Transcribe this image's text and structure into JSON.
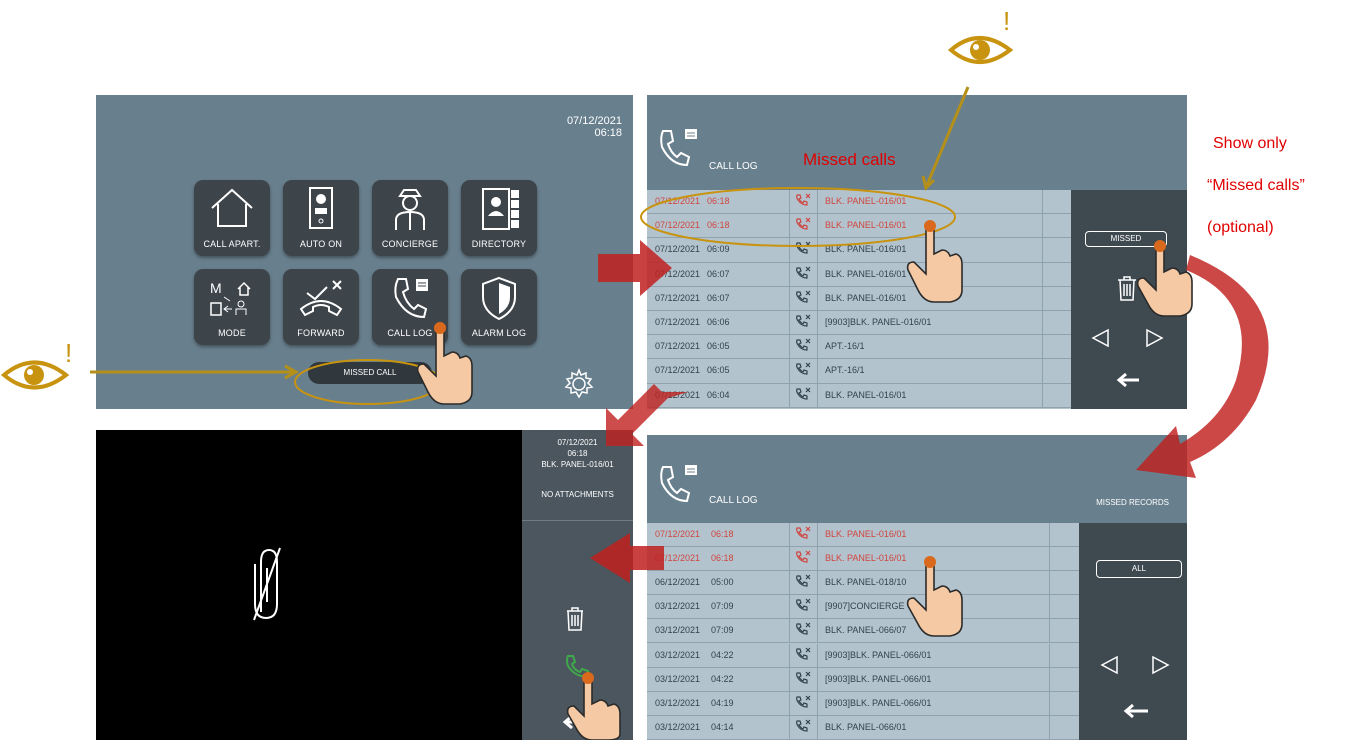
{
  "home": {
    "date": "07/12/2021",
    "time": "06:18",
    "tiles": [
      {
        "label": "CALL APART."
      },
      {
        "label": "AUTO ON"
      },
      {
        "label": "CONCIERGE"
      },
      {
        "label": "DIRECTORY"
      },
      {
        "label": "MODE"
      },
      {
        "label": "FORWARD"
      },
      {
        "label": "CALL LOG"
      },
      {
        "label": "ALARM LOG"
      }
    ],
    "missed_call": "MISSED CALL"
  },
  "call_log": {
    "title": "CALL LOG",
    "missed_button": "MISSED",
    "rows": [
      {
        "date": "07/12/2021",
        "time": "06:18",
        "name": "BLK. PANEL-016/01",
        "missed": true
      },
      {
        "date": "07/12/2021",
        "time": "06:18",
        "name": "BLK. PANEL-016/01",
        "missed": true
      },
      {
        "date": "07/12/2021",
        "time": "06:09",
        "name": "BLK. PANEL-016/01",
        "missed": false
      },
      {
        "date": "07/12/2021",
        "time": "06:07",
        "name": "BLK. PANEL-016/01",
        "missed": false
      },
      {
        "date": "07/12/2021",
        "time": "06:07",
        "name": "BLK. PANEL-016/01",
        "missed": false
      },
      {
        "date": "07/12/2021",
        "time": "06:06",
        "name": "[9903]BLK. PANEL-016/01",
        "missed": false
      },
      {
        "date": "07/12/2021",
        "time": "06:05",
        "name": "APT.-16/1",
        "missed": false
      },
      {
        "date": "07/12/2021",
        "time": "06:05",
        "name": "APT.-16/1",
        "missed": false
      },
      {
        "date": "07/12/2021",
        "time": "06:04",
        "name": "BLK. PANEL-016/01",
        "missed": false
      }
    ]
  },
  "missed_log": {
    "title": "CALL LOG",
    "subtitle": "MISSED RECORDS",
    "all_button": "ALL",
    "rows": [
      {
        "date": "07/12/2021",
        "time": "06:18",
        "name": "BLK. PANEL-016/01",
        "missed": true
      },
      {
        "date": "07/12/2021",
        "time": "06:18",
        "name": "BLK. PANEL-016/01",
        "missed": true
      },
      {
        "date": "06/12/2021",
        "time": "05:00",
        "name": "BLK. PANEL-018/10",
        "missed": false
      },
      {
        "date": "03/12/2021",
        "time": "07:09",
        "name": "[9907]CONCIERGE",
        "missed": false
      },
      {
        "date": "03/12/2021",
        "time": "07:09",
        "name": "BLK. PANEL-066/07",
        "missed": false
      },
      {
        "date": "03/12/2021",
        "time": "04:22",
        "name": "[9903]BLK. PANEL-066/01",
        "missed": false
      },
      {
        "date": "03/12/2021",
        "time": "04:22",
        "name": "[9903]BLK. PANEL-066/01",
        "missed": false
      },
      {
        "date": "03/12/2021",
        "time": "04:19",
        "name": "[9903]BLK. PANEL-066/01",
        "missed": false
      },
      {
        "date": "03/12/2021",
        "time": "04:14",
        "name": "BLK. PANEL-066/01",
        "missed": false
      }
    ]
  },
  "viewer": {
    "date": "07/12/2021",
    "time": "06:18",
    "caller": "BLK. PANEL-016/01",
    "attachments": "NO ATTACHMENTS"
  },
  "annotations": {
    "missed_calls": "Missed calls",
    "show_only_1": "Show only",
    "show_only_2": "“Missed calls”",
    "show_only_3": "(optional)",
    "exclamation": "!"
  },
  "colors": {
    "screen_bg": "#687f8d",
    "list_bg": "#b3c3ce",
    "missed_text": "#d0453e",
    "annotation_red": "#e00000",
    "eye_gold": "#c8930f"
  }
}
